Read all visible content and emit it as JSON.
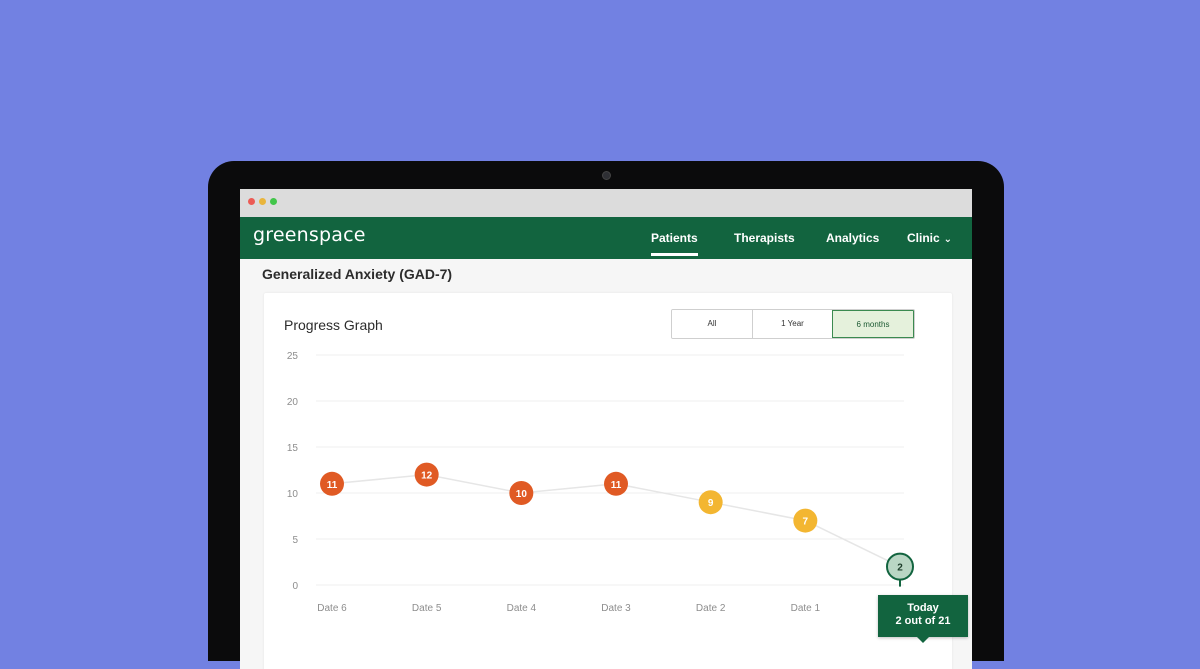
{
  "app": {
    "logo": "greenspace"
  },
  "nav": {
    "items": [
      {
        "label": "Patients",
        "active": true
      },
      {
        "label": "Therapists",
        "active": false
      },
      {
        "label": "Analytics",
        "active": false
      },
      {
        "label": "Clinic",
        "active": false,
        "has_dropdown": true
      }
    ]
  },
  "page": {
    "section_title": "Generalized Anxiety (GAD-7)"
  },
  "card": {
    "title": "Progress Graph",
    "ranges": [
      {
        "label": "All",
        "active": false
      },
      {
        "label": "1 Year",
        "active": false
      },
      {
        "label": "6 months",
        "active": true
      }
    ]
  },
  "tooltip": {
    "line1": "Today",
    "line2": "2 out of 21"
  },
  "colors": {
    "background": "#7281e2",
    "brand_green": "#12643f",
    "severe": "#e05a24",
    "moderate": "#f3b631",
    "minimal": "#b9d6c4"
  },
  "chart_data": {
    "type": "line",
    "categories": [
      "Date 6",
      "Date 5",
      "Date 4",
      "Date 3",
      "Date 2",
      "Date 1",
      "Today"
    ],
    "values": [
      11,
      12,
      10,
      11,
      9,
      7,
      2
    ],
    "point_labels": [
      "11",
      "12",
      "10",
      "11",
      "9",
      "7",
      "2"
    ],
    "point_colors": [
      "#e05a24",
      "#e05a24",
      "#e05a24",
      "#e05a24",
      "#f3b631",
      "#f3b631",
      "#b9d6c4"
    ],
    "yticks": [
      "0",
      "5",
      "10",
      "15",
      "20",
      "25"
    ],
    "ytick_values": [
      0,
      5,
      10,
      15,
      20,
      25
    ],
    "ylim": [
      0,
      25
    ],
    "grid": true
  }
}
